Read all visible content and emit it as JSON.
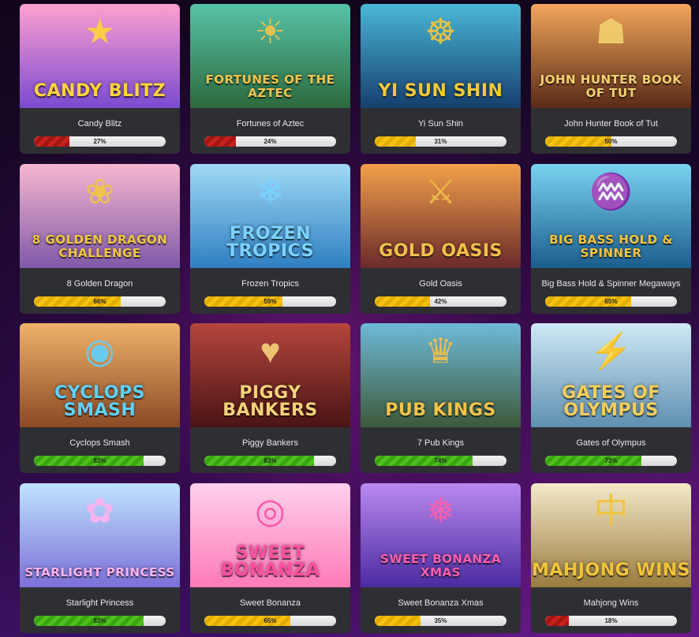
{
  "games": [
    {
      "name": "Candy Blitz",
      "logo": "CANDY BLITZ",
      "percent": 27,
      "level": "red",
      "art": "candy-icon",
      "bg": [
        "#ff9fd0",
        "#7a4bd0"
      ],
      "logo_color": "#ffd43a"
    },
    {
      "name": "Fortunes of Aztec",
      "logo": "FORTUNES OF THE AZTEC",
      "percent": 24,
      "level": "red",
      "art": "feather-headdress-icon",
      "bg": [
        "#57c3a6",
        "#2c6a3e"
      ],
      "logo_color": "#f2c44c"
    },
    {
      "name": "Yi Sun Shin",
      "logo": "YI SUN SHIN",
      "percent": 31,
      "level": "yellow",
      "art": "ship-wheel-icon",
      "bg": [
        "#4ab7d6",
        "#163f6e"
      ],
      "logo_color": "#f5c83a"
    },
    {
      "name": "John Hunter Book of Tut",
      "logo": "JOHN HUNTER BOOK OF TUT",
      "percent": 50,
      "level": "yellow",
      "art": "cowboy-hat-icon",
      "bg": [
        "#f2a65a",
        "#5a2b18"
      ],
      "logo_color": "#f3d170"
    },
    {
      "name": "8 Golden Dragon",
      "logo": "8 GOLDEN DRAGON CHALLENGE",
      "percent": 66,
      "level": "yellow",
      "art": "dragon-icon",
      "bg": [
        "#f7b6d0",
        "#7f5aa8"
      ],
      "logo_color": "#f2c73f"
    },
    {
      "name": "Frozen Tropics",
      "logo": "FROZEN TROPICS",
      "percent": 59,
      "level": "yellow",
      "art": "penguin-icon",
      "bg": [
        "#9fd9f5",
        "#2f7fc1"
      ],
      "logo_color": "#7ad3ff"
    },
    {
      "name": "Gold Oasis",
      "logo": "GOLD OASIS",
      "percent": 42,
      "level": "yellow",
      "art": "warrior-icon",
      "bg": [
        "#f3a04b",
        "#6a2a2a"
      ],
      "logo_color": "#f0c04a"
    },
    {
      "name": "Big Bass Hold & Spinner Megaways",
      "logo": "BIG BASS HOLD & SPINNER",
      "percent": 65,
      "level": "yellow",
      "art": "fish-icon",
      "bg": [
        "#79d3f0",
        "#1b5d8d"
      ],
      "logo_color": "#f6c43b"
    },
    {
      "name": "Cyclops Smash",
      "logo": "CYCLOPS SMASH",
      "percent": 83,
      "level": "green",
      "art": "cyclops-icon",
      "bg": [
        "#f0b26a",
        "#8a4a25"
      ],
      "logo_color": "#5fd0ff"
    },
    {
      "name": "Piggy Bankers",
      "logo": "PIGGY BANKERS",
      "percent": 83,
      "level": "green",
      "art": "pig-icon",
      "bg": [
        "#b5463e",
        "#4a1414"
      ],
      "logo_color": "#f6d27a"
    },
    {
      "name": "7 Pub Kings",
      "logo": "PUB KINGS",
      "percent": 74,
      "level": "green",
      "art": "viking-icon",
      "bg": [
        "#6fb9d8",
        "#3c5a3a"
      ],
      "logo_color": "#f2c34a"
    },
    {
      "name": "Gates of Olympus",
      "logo": "GATES OF OLYMPUS",
      "percent": 73,
      "level": "green",
      "art": "zeus-icon",
      "bg": [
        "#cfe9f6",
        "#5f8fb0"
      ],
      "logo_color": "#f4cf5a"
    },
    {
      "name": "Starlight Princess",
      "logo": "STARLIGHT PRINCESS",
      "percent": 83,
      "level": "green",
      "art": "princess-icon",
      "bg": [
        "#bfe3ff",
        "#7b6fd8"
      ],
      "logo_color": "#ffb3f0"
    },
    {
      "name": "Sweet Bonanza",
      "logo": "SWEET BONANZA",
      "percent": 65,
      "level": "yellow",
      "art": "lollipop-icon",
      "bg": [
        "#ffd1ec",
        "#ff7ab8"
      ],
      "logo_color": "#ff4fa3"
    },
    {
      "name": "Sweet Bonanza Xmas",
      "logo": "SWEET BONANZA XMAS",
      "percent": 35,
      "level": "yellow",
      "art": "candy-cane-icon",
      "bg": [
        "#b98af0",
        "#4b2aa0"
      ],
      "logo_color": "#ff5fae"
    },
    {
      "name": "Mahjong Wins",
      "logo": "MAHJONG WINS",
      "percent": 18,
      "level": "red",
      "art": "mahjong-tile-icon",
      "bg": [
        "#f4e9c9",
        "#9a7b3d"
      ],
      "logo_color": "#f2c43a"
    }
  ],
  "art_glyphs": {
    "candy-icon": "★",
    "feather-headdress-icon": "☀",
    "ship-wheel-icon": "☸",
    "cowboy-hat-icon": "☗",
    "dragon-icon": "❀",
    "penguin-icon": "❄",
    "warrior-icon": "⚔",
    "fish-icon": "♒",
    "cyclops-icon": "◉",
    "pig-icon": "♥",
    "viking-icon": "♛",
    "zeus-icon": "⚡",
    "princess-icon": "✿",
    "lollipop-icon": "◎",
    "candy-cane-icon": "❅",
    "mahjong-tile-icon": "中"
  }
}
